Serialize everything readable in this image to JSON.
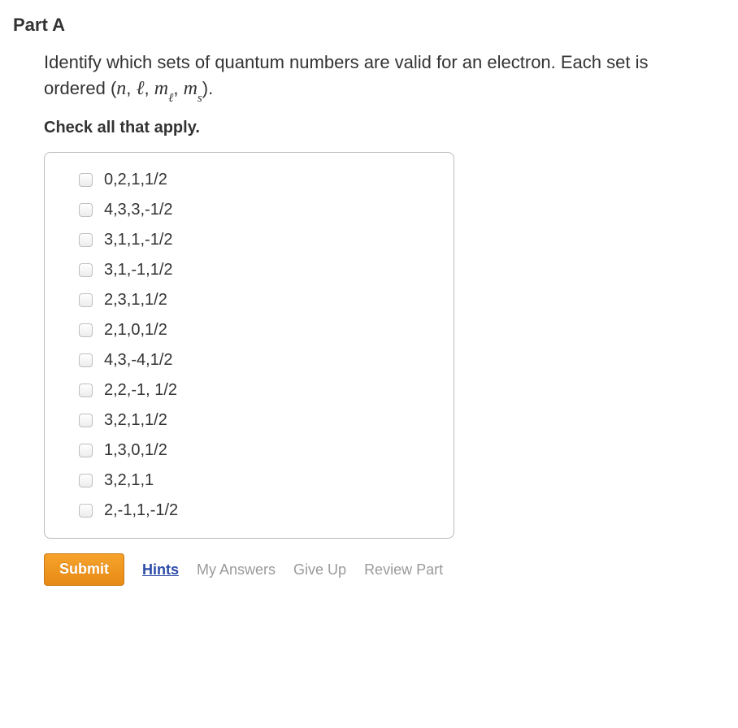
{
  "part_label": "Part A",
  "question": {
    "prefix": "Identify which sets of quantum numbers are valid for an electron. Each set is ordered (",
    "n": "n",
    "l": "ℓ",
    "ml_m": "m",
    "ml_sub": "ℓ",
    "ms_m": "m",
    "ms_sub": "s",
    "suffix": ")."
  },
  "check_all_label": "Check all that apply.",
  "options": [
    "0,2,1,1/2",
    "4,3,3,-1/2",
    "3,1,1,-1/2",
    "3,1,-1,1/2",
    "2,3,1,1/2",
    "2,1,0,1/2",
    "4,3,-4,1/2",
    "2,2,-1, 1/2",
    "3,2,1,1/2",
    "1,3,0,1/2",
    "3,2,1,1",
    "2,-1,1,-1/2"
  ],
  "actions": {
    "submit": "Submit",
    "hints": "Hints",
    "my_answers": "My Answers",
    "give_up": "Give Up",
    "review_part": "Review Part"
  }
}
